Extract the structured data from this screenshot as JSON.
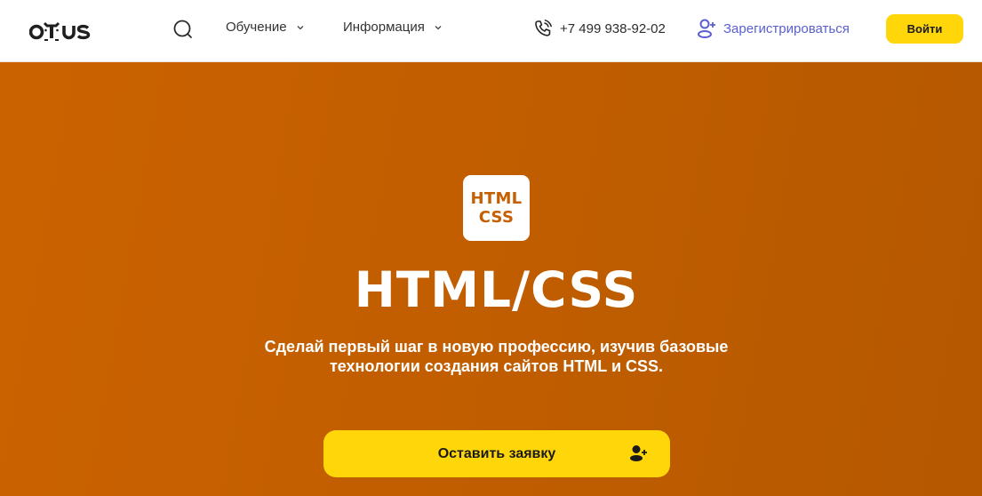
{
  "header": {
    "logo_text": "otus",
    "nav": [
      {
        "label": "Обучение",
        "icon": "chevron-down-icon"
      },
      {
        "label": "Информация",
        "icon": "chevron-down-icon"
      }
    ],
    "search_icon": "search-icon",
    "phone": {
      "icon": "phone-icon",
      "number": "+7 499 938-92-02"
    },
    "register": {
      "icon": "user-plus-icon",
      "label": "Зарегистрироваться",
      "color": "#5a5fd0"
    },
    "login_label": "Войти",
    "accent_color": "#ffd60a"
  },
  "hero": {
    "badge_lines": [
      "HTML",
      "CSS"
    ],
    "title": "HTML/CSS",
    "subtitle_lines": [
      "Сделай первый шаг в новую профессию, изучив базовые",
      "технологии создания сайтов HTML и CSS."
    ],
    "cta_label": "Оставить заявку",
    "cta_icon": "user-plus-icon",
    "background_colors": [
      "#cb6200",
      "#b55800"
    ]
  }
}
